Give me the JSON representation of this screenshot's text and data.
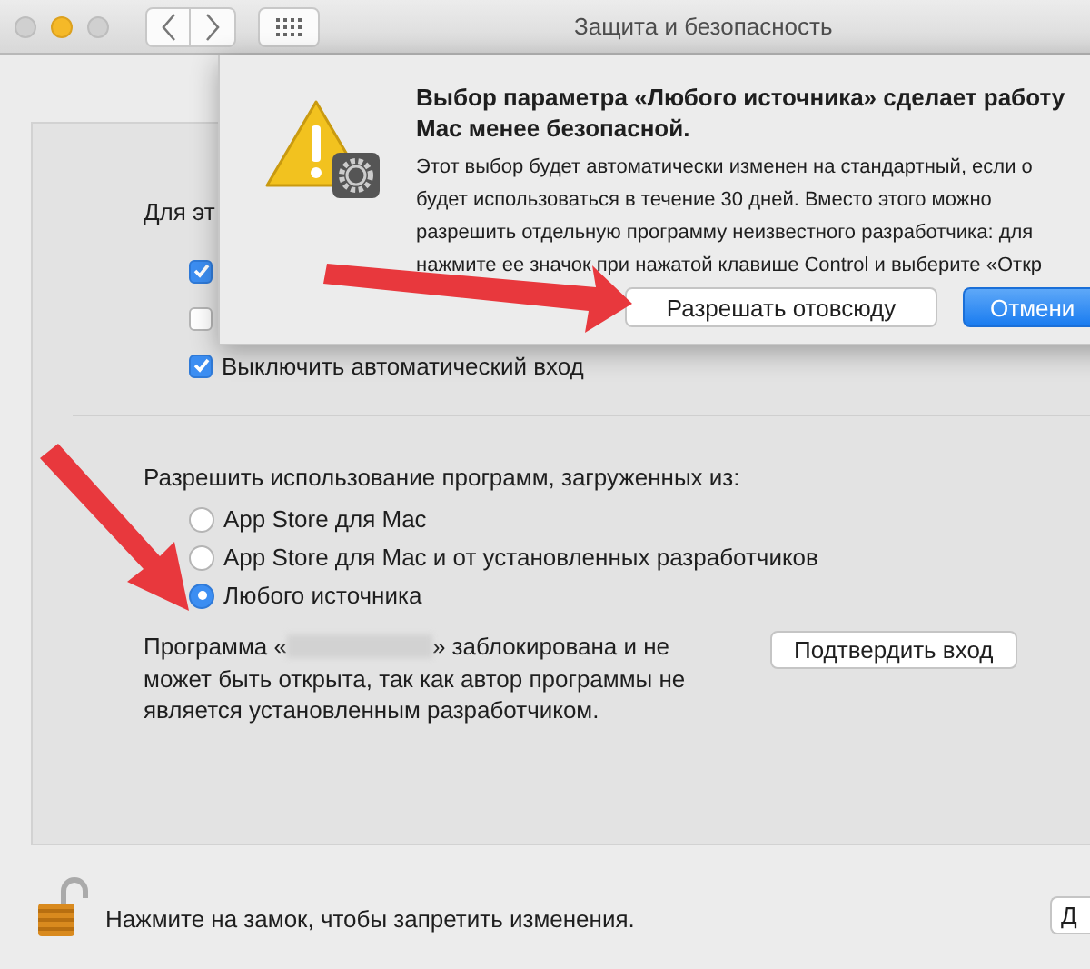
{
  "window": {
    "title": "Защита и безопасность"
  },
  "general": {
    "heading": "Для эт",
    "checkboxes": [
      {
        "checked": true
      },
      {
        "checked": false
      },
      {
        "checked": true,
        "label": "Выключить автоматический вход"
      }
    ]
  },
  "downloads": {
    "heading": "Разрешить использование программ, загруженных из:",
    "options": [
      {
        "label": "App Store для Mac",
        "selected": false
      },
      {
        "label": "App Store для Mac и от установленных разработчиков",
        "selected": false
      },
      {
        "label": "Любого источника",
        "selected": true
      }
    ],
    "blocked_message": {
      "before": "Программа «",
      "after": "» заблокирована и не может быть открыта, так как автор программы не является установленным разработчиком."
    },
    "confirm_button": "Подтвердить вход"
  },
  "footer": {
    "lock_text": "Нажмите на замок, чтобы запретить изменения.",
    "button": "Д"
  },
  "dialog": {
    "title_lines": [
      "Выбор параметра «Любого источника» сделает работу",
      "Mac менее безопасной."
    ],
    "body_lines": [
      "Этот выбор будет автоматически изменен на стандартный, если о",
      "будет использоваться в течение 30 дней. Вместо этого можно",
      "разрешить отдельную программу неизвестного разработчика: для",
      "нажмите ее значок при нажатой клавише Control и выберите «Откр"
    ],
    "buttons": [
      {
        "label": "Разрешать отовсюду",
        "kind": "plain"
      },
      {
        "label": "Отмени",
        "kind": "primary"
      }
    ]
  }
}
